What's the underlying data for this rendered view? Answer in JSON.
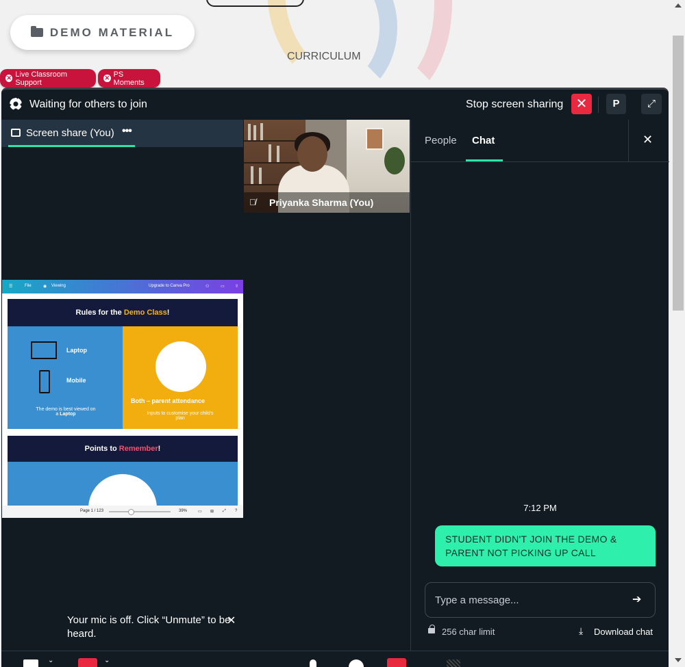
{
  "header": {
    "demo_material_label": "DEMO MATERIAL",
    "curriculum_label": "CURRICULUM",
    "chips": [
      {
        "label": "Live Classroom Support"
      },
      {
        "label": "PS Moments"
      }
    ]
  },
  "meeting": {
    "status_text": "Waiting for others to join",
    "stop_sharing_label": "Stop screen sharing",
    "profile_initial": "P",
    "screen_share_label": "Screen share (You)",
    "participant_name": "Priyanka Sharma (You)",
    "mic_toast": "Your mic is off. Click “Unmute” to be heard."
  },
  "slide": {
    "menu": "File",
    "view_mode": "Viewing",
    "upgrade": "Upgrade to Canva Pro",
    "title1_prefix": "Rules for the ",
    "title1_highlight": "Demo Class",
    "title1_suffix": "!",
    "laptop": "Laptop",
    "mobile": "Mobile",
    "note_prefix": "The demo is best viewed on a ",
    "note_bold": "Laptop",
    "attendance": "Both – parent attendance",
    "inputs_note": "Inputs to customise your child's plan",
    "title2_prefix": "Points to ",
    "title2_highlight": "Remember",
    "title2_suffix": "!",
    "page_indicator": "Page 1 / 123",
    "zoom": "39%"
  },
  "chat": {
    "tabs": [
      {
        "label": "People",
        "active": false
      },
      {
        "label": "Chat",
        "active": true
      }
    ],
    "messages": [
      {
        "time": "7:12 PM",
        "text": "STUDENT DIDN'T JOIN THE DEMO & PARENT NOT PICKING UP CALL"
      }
    ],
    "input_placeholder": "Type a message...",
    "char_limit": "256 char limit",
    "download_label": "Download chat"
  },
  "colors": {
    "accent_green": "#2de3a7",
    "bubble_green": "#2ef0ac",
    "danger_red": "#e8293f",
    "chip_red": "#c8143c",
    "meeting_bg": "#121b22"
  }
}
